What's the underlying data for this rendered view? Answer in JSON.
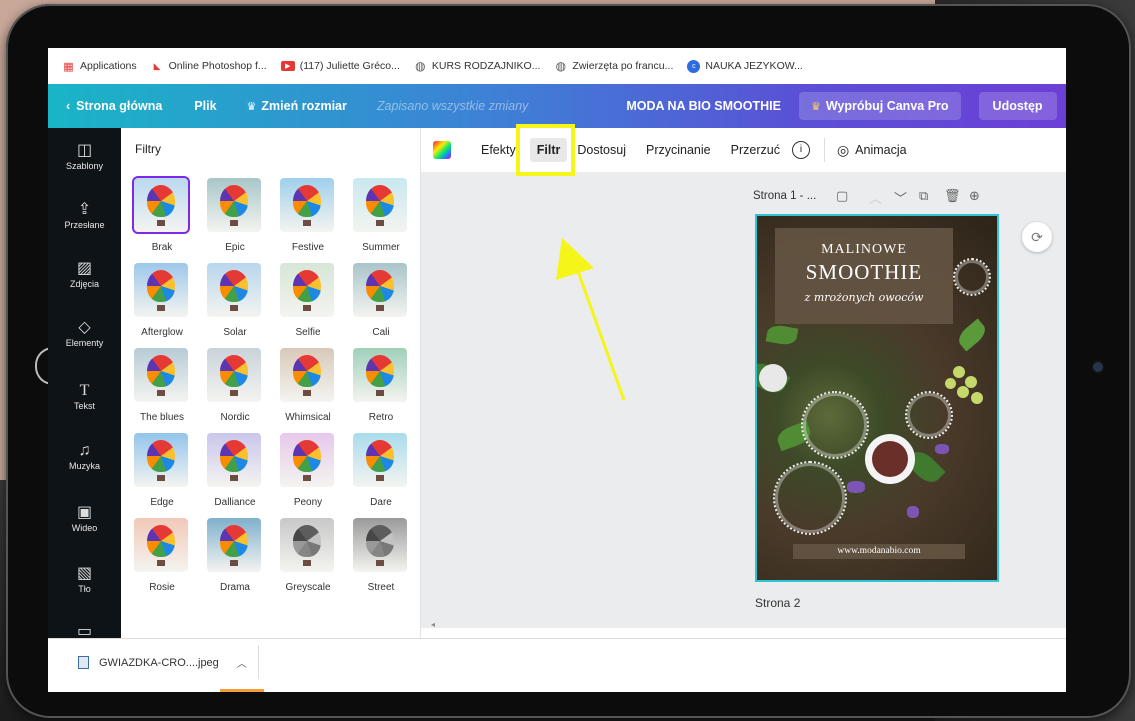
{
  "bookmarks": [
    {
      "label": "Applications",
      "icon": "apps-grid-icon"
    },
    {
      "label": "Online Photoshop f...",
      "icon": "photoshop-icon"
    },
    {
      "label": "(117) Juliette Gréco...",
      "icon": "youtube-icon"
    },
    {
      "label": "KURS RODZAJNIKO...",
      "icon": "globe-icon"
    },
    {
      "label": "Zwierzęta po francu...",
      "icon": "globe-icon"
    },
    {
      "label": "NAUKA JEZYKOW...",
      "icon": "chrome-icon"
    }
  ],
  "header": {
    "back": "Strona główna",
    "file": "Plik",
    "resize": "Zmień rozmiar",
    "saved": "Zapisano wszystkie zmiany",
    "doc_title": "MODA NA BIO SMOOTHIE",
    "try_pro": "Wypróbuj Canva Pro",
    "share": "Udostęp"
  },
  "rail": [
    {
      "label": "Szablony",
      "icon": "templates-icon"
    },
    {
      "label": "Przesłane",
      "icon": "upload-icon"
    },
    {
      "label": "Zdjęcia",
      "icon": "photos-icon"
    },
    {
      "label": "Elementy",
      "icon": "elements-icon"
    },
    {
      "label": "Tekst",
      "icon": "text-icon"
    },
    {
      "label": "Muzyka",
      "icon": "music-icon"
    },
    {
      "label": "Wideo",
      "icon": "video-icon"
    },
    {
      "label": "Tło",
      "icon": "background-icon"
    },
    {
      "label": "",
      "icon": "folder-icon"
    }
  ],
  "panel": {
    "title": "Filtry",
    "filters": [
      {
        "label": "Brak",
        "selected": true,
        "tint": "#b9d8f0"
      },
      {
        "label": "Epic",
        "selected": false,
        "tint": "#a8c6c8"
      },
      {
        "label": "Festive",
        "selected": false,
        "tint": "#9fd0ec"
      },
      {
        "label": "Summer",
        "selected": false,
        "tint": "#c8e8f0"
      },
      {
        "label": "Afterglow",
        "selected": false,
        "tint": "#9dc7ea"
      },
      {
        "label": "Solar",
        "selected": false,
        "tint": "#b8d6ee"
      },
      {
        "label": "Selfie",
        "selected": false,
        "tint": "#d6e6d6"
      },
      {
        "label": "Cali",
        "selected": false,
        "tint": "#a9c4c9"
      },
      {
        "label": "The blues",
        "selected": false,
        "tint": "#b7cbd6"
      },
      {
        "label": "Nordic",
        "selected": false,
        "tint": "#c9d3da"
      },
      {
        "label": "Whimsical",
        "selected": false,
        "tint": "#d8c9b9"
      },
      {
        "label": "Retro",
        "selected": false,
        "tint": "#9fd0b8"
      },
      {
        "label": "Edge",
        "selected": false,
        "tint": "#92c4ec"
      },
      {
        "label": "Dalliance",
        "selected": false,
        "tint": "#c9c6ec"
      },
      {
        "label": "Peony",
        "selected": false,
        "tint": "#e6c8ec"
      },
      {
        "label": "Dare",
        "selected": false,
        "tint": "#a9dcec"
      },
      {
        "label": "Rosie",
        "selected": false,
        "tint": "#f2c8b8"
      },
      {
        "label": "Drama",
        "selected": false,
        "tint": "#7fb0cc"
      },
      {
        "label": "Greyscale",
        "selected": false,
        "tint": "#c8c8c8"
      },
      {
        "label": "Street",
        "selected": false,
        "tint": "#9a9a9a"
      }
    ]
  },
  "toolbar": {
    "effects": "Efekty",
    "filter": "Filtr",
    "adjust": "Dostosuj",
    "crop": "Przycinanie",
    "flip": "Przerzuć",
    "animate": "Animacja"
  },
  "canvas": {
    "page1_label": "Strona 1 - ...",
    "page2_label": "Strona 2",
    "design": {
      "line1": "MALINOWE",
      "line2": "SMOOTHIE",
      "line3": "z mrożonych owoców",
      "url": "www.modanabio.com"
    }
  },
  "downloads": {
    "file": "GWIAZDKA-CRO....jpeg"
  },
  "colors": {
    "highlight": "#f5f51a",
    "selection": "#7d2ae8",
    "page_border": "#2fc4d6"
  }
}
